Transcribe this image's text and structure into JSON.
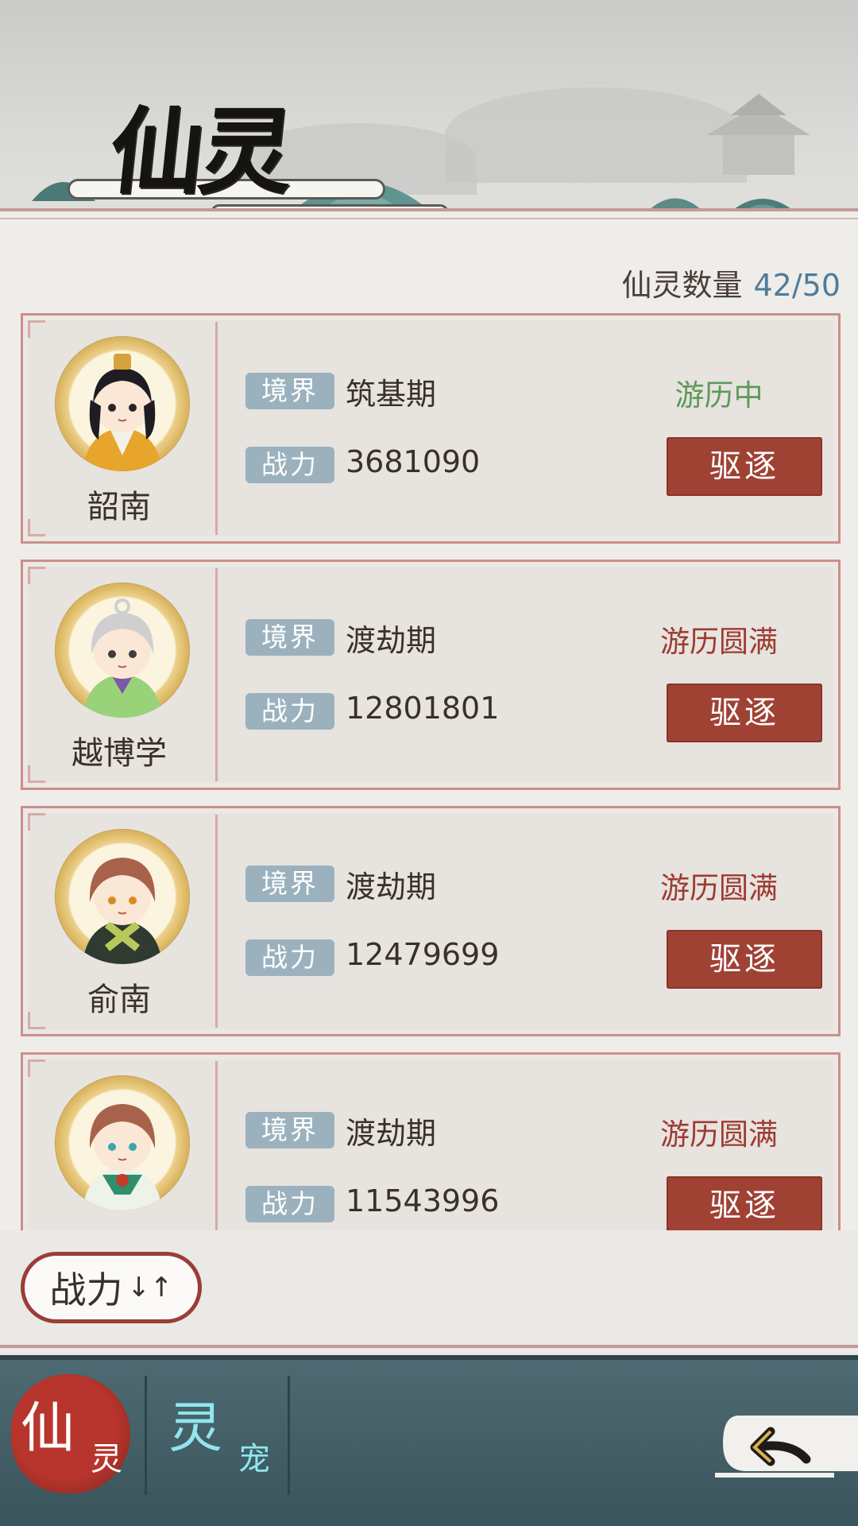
{
  "page": {
    "title": "仙灵"
  },
  "count": {
    "label": "仙灵数量",
    "value": "42/50"
  },
  "labels": {
    "realm": "境界",
    "power": "战力",
    "expel": "驱逐"
  },
  "spirits": [
    {
      "name": "韶南",
      "realm": "筑基期",
      "power": "3681090",
      "status": "游历中",
      "status_color": "#5c9a5a"
    },
    {
      "name": "越博学",
      "realm": "渡劫期",
      "power": "12801801",
      "status": "游历圆满",
      "status_color": "#9d3b31"
    },
    {
      "name": "俞南",
      "realm": "渡劫期",
      "power": "12479699",
      "status": "游历圆满",
      "status_color": "#9d3b31"
    },
    {
      "name": "",
      "realm": "渡劫期",
      "power": "11543996",
      "status": "游历圆满",
      "status_color": "#9d3b31"
    }
  ],
  "sort": {
    "label": "战力",
    "icon": "sort-arrows-icon"
  },
  "nav": {
    "tabs": [
      {
        "main": "仙",
        "sub": "灵",
        "active": true
      },
      {
        "main": "灵",
        "sub": "宠",
        "active": false
      }
    ],
    "back_icon": "back-arrow-icon"
  },
  "colors": {
    "expel_button": "#9f4234",
    "tag_bg": "#9bb2be",
    "count_value": "#4f7b9b",
    "nav_active": "#b7352d",
    "nav_inactive_text": "#8fe6ee"
  }
}
